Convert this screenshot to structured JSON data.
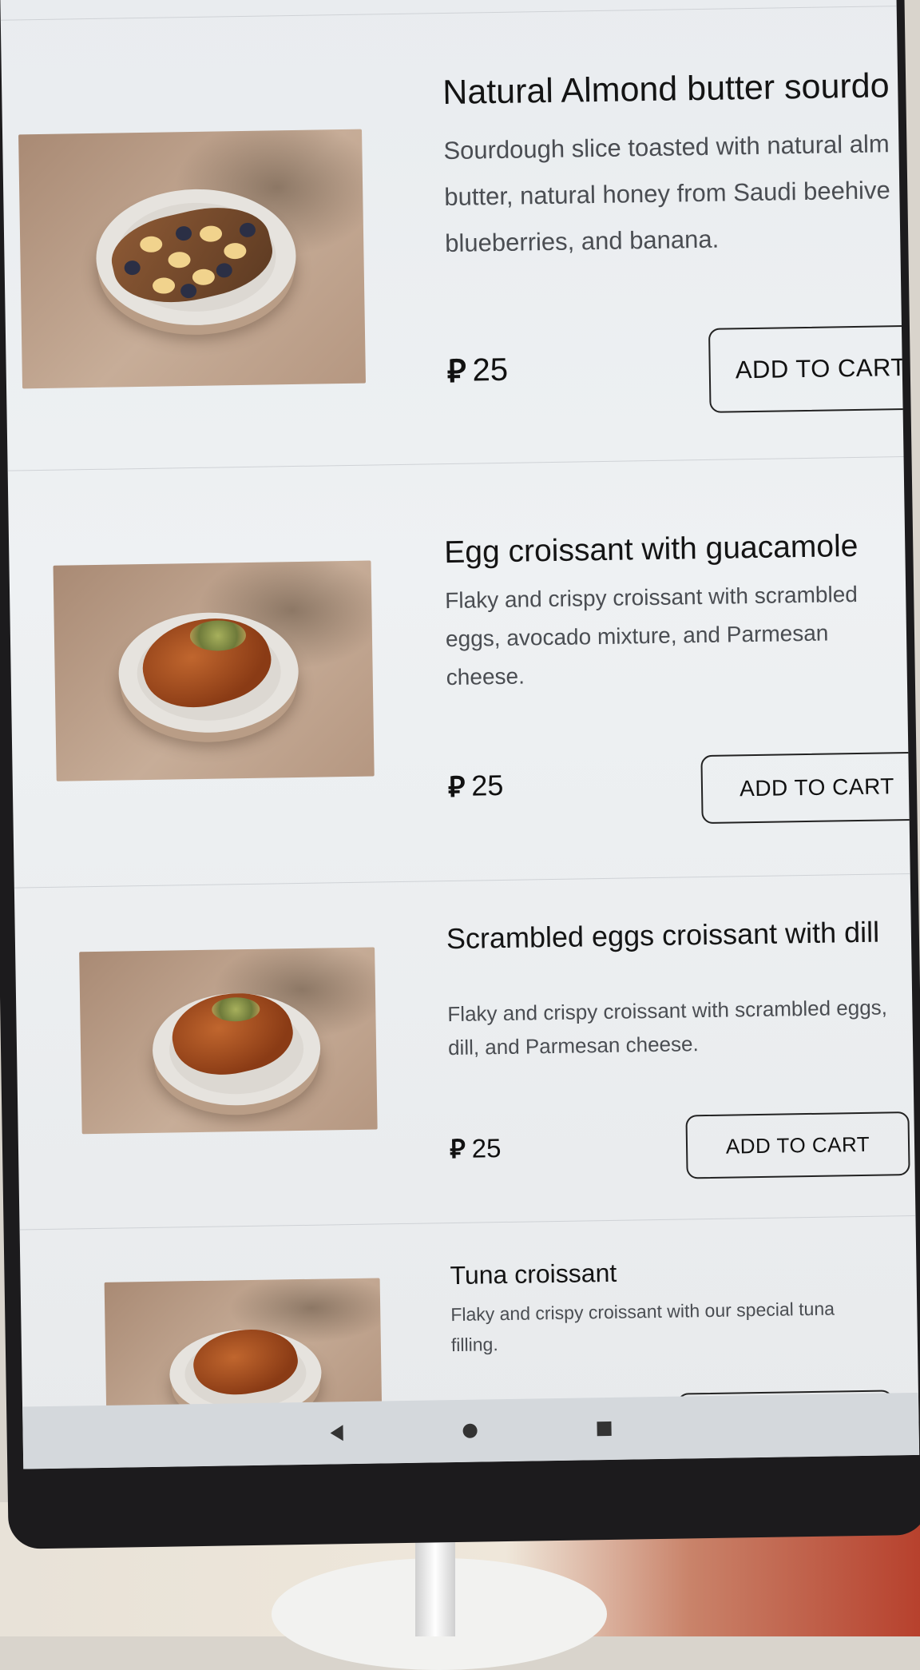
{
  "currency_symbol": "⃁",
  "menu": {
    "items": [
      {
        "title": "Natural Almond butter sourdo",
        "description": "Sourdough slice toasted with natural alm butter, natural honey from Saudi beehive blueberries, and banana.",
        "price": "25",
        "button_label": "ADD TO CART"
      },
      {
        "title": "Egg croissant with guacamole",
        "description": "Flaky and crispy croissant with scrambled eggs, avocado mixture, and Parmesan cheese.",
        "price": "25",
        "button_label": "ADD TO CART"
      },
      {
        "title": "Scrambled eggs croissant with dill",
        "description": "Flaky and crispy croissant with scrambled eggs, dill, and Parmesan cheese.",
        "price": "25",
        "button_label": "ADD TO CART"
      },
      {
        "title": "Tuna croissant",
        "description": "Flaky and crispy croissant with our special tuna filling.",
        "price": "",
        "button_label": ""
      }
    ]
  },
  "system_nav": {
    "back_icon": "triangle-left",
    "home_icon": "circle",
    "recents_icon": "square"
  }
}
